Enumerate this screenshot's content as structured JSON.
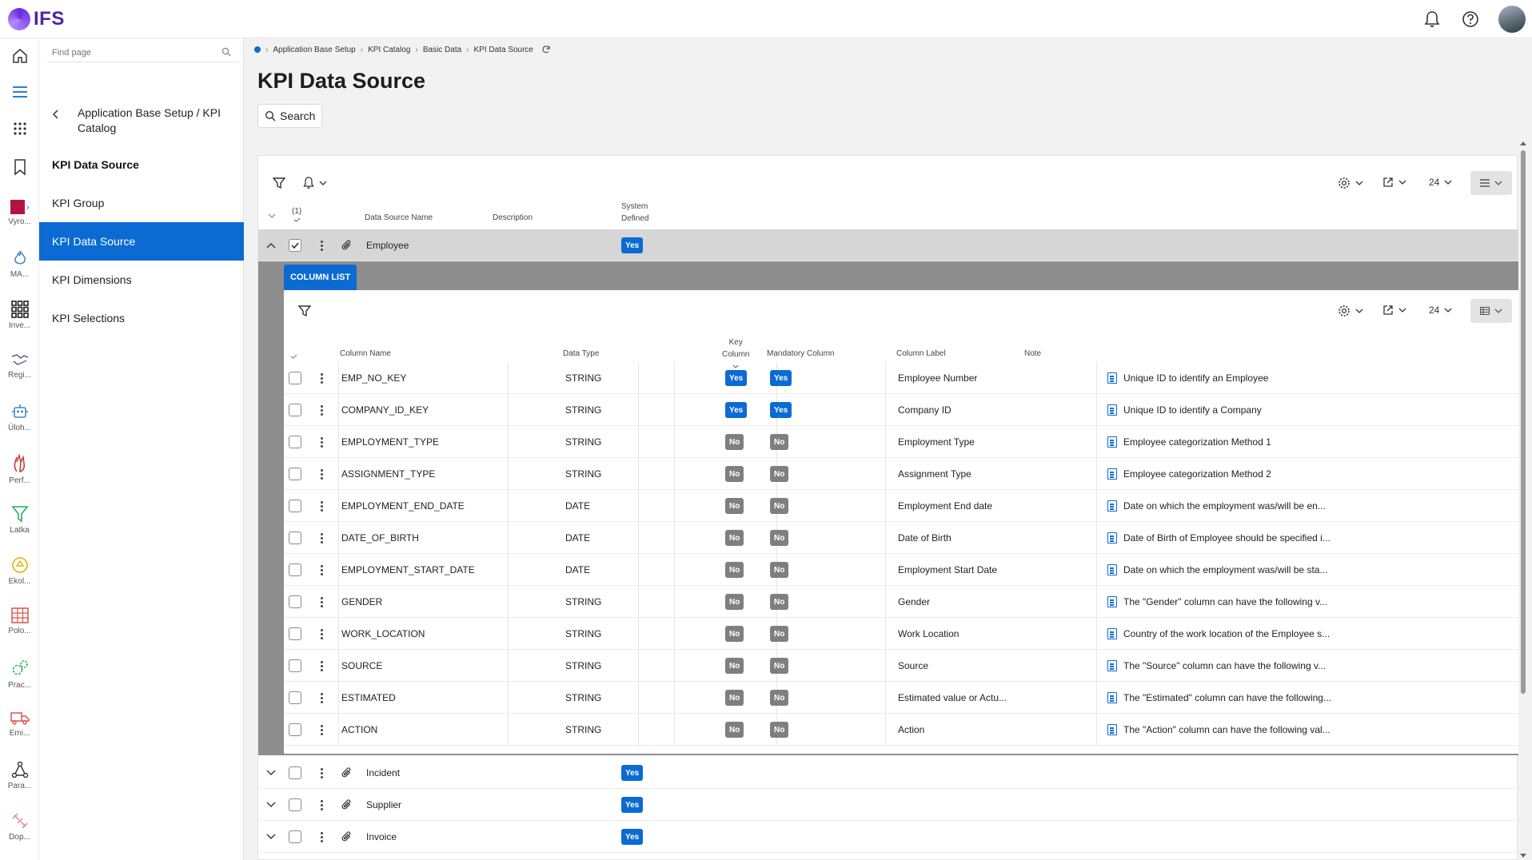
{
  "app": {
    "logo_text": "IFS"
  },
  "topbar": {
    "icons": [
      "bell-icon",
      "help-icon",
      "avatar"
    ]
  },
  "rail": {
    "items": [
      {
        "icon": "home-icon",
        "label": ""
      },
      {
        "icon": "menu-icon",
        "label": ""
      },
      {
        "icon": "apps-grid-icon",
        "label": ""
      },
      {
        "icon": "bookmark-icon",
        "label": ""
      },
      {
        "icon": "square-icon",
        "label": "Vyro..."
      },
      {
        "icon": "flame-icon",
        "label": "MA..."
      },
      {
        "icon": "grid-icon",
        "label": "Inve..."
      },
      {
        "icon": "handshake-icon",
        "label": "Regi..."
      },
      {
        "icon": "robot-icon",
        "label": "Úloh..."
      },
      {
        "icon": "hand-icon",
        "label": "Perf..."
      },
      {
        "icon": "funnel-icon",
        "label": "Latka"
      },
      {
        "icon": "recycle-icon",
        "label": "Ekol..."
      },
      {
        "icon": "table-icon",
        "label": "Polo..."
      },
      {
        "icon": "gears-icon",
        "label": "Prac..."
      },
      {
        "icon": "truck-icon",
        "label": "Emi..."
      },
      {
        "icon": "network-icon",
        "label": "Para..."
      },
      {
        "icon": "satellite-icon",
        "label": "Dop..."
      }
    ]
  },
  "nav": {
    "search_placeholder": "Find page",
    "parent": "Application Base Setup / KPI Catalog",
    "title": "KPI Data Source",
    "items": [
      {
        "label": "KPI Group",
        "active": false
      },
      {
        "label": "KPI Data Source",
        "active": true
      },
      {
        "label": "KPI Dimensions",
        "active": false
      },
      {
        "label": "KPI Selections",
        "active": false
      }
    ]
  },
  "breadcrumb": [
    "Application Base Setup",
    "KPI Catalog",
    "Basic Data",
    "KPI Data Source"
  ],
  "page": {
    "title": "KPI Data Source",
    "search_label": "Search"
  },
  "main_grid": {
    "page_size": "24",
    "selection_count": "(1)",
    "headers": {
      "name": "Data Source Name",
      "description": "Description",
      "system_defined_1": "System",
      "system_defined_2": "Defined"
    },
    "rows": [
      {
        "name": "Employee",
        "system_defined": "Yes",
        "expanded": true,
        "checked": true
      },
      {
        "name": "Incident",
        "system_defined": "Yes",
        "expanded": false,
        "checked": false
      },
      {
        "name": "Supplier",
        "system_defined": "Yes",
        "expanded": false,
        "checked": false
      },
      {
        "name": "Invoice",
        "system_defined": "Yes",
        "expanded": false,
        "checked": false
      }
    ]
  },
  "column_list": {
    "tab_label": "COLUMN LIST",
    "page_size": "24",
    "headers": {
      "column_name": "Column Name",
      "data_type": "Data Type",
      "key_column_1": "Key",
      "key_column_2": "Column",
      "mandatory": "Mandatory Column",
      "label": "Column Label",
      "note": "Note"
    },
    "rows": [
      {
        "name": "EMP_NO_KEY",
        "type": "STRING",
        "key": "Yes",
        "mandatory": "Yes",
        "label": "Employee Number",
        "note": "Unique ID to identify an Employee"
      },
      {
        "name": "COMPANY_ID_KEY",
        "type": "STRING",
        "key": "Yes",
        "mandatory": "Yes",
        "label": "Company ID",
        "note": "Unique ID to identify a Company"
      },
      {
        "name": "EMPLOYMENT_TYPE",
        "type": "STRING",
        "key": "No",
        "mandatory": "No",
        "label": "Employment Type",
        "note": "Employee categorization Method 1"
      },
      {
        "name": "ASSIGNMENT_TYPE",
        "type": "STRING",
        "key": "No",
        "mandatory": "No",
        "label": "Assignment Type",
        "note": "Employee categorization Method 2"
      },
      {
        "name": "EMPLOYMENT_END_DATE",
        "type": "DATE",
        "key": "No",
        "mandatory": "No",
        "label": "Employment End date",
        "note": "Date on which the employment was/will be en..."
      },
      {
        "name": "DATE_OF_BIRTH",
        "type": "DATE",
        "key": "No",
        "mandatory": "No",
        "label": "Date of Birth",
        "note": "Date of Birth of Employee should be specified i..."
      },
      {
        "name": "EMPLOYMENT_START_DATE",
        "type": "DATE",
        "key": "No",
        "mandatory": "No",
        "label": "Employment Start Date",
        "note": "Date on which the employment was/will be sta..."
      },
      {
        "name": "GENDER",
        "type": "STRING",
        "key": "No",
        "mandatory": "No",
        "label": "Gender",
        "note": "The \"Gender\" column can have the following v..."
      },
      {
        "name": "WORK_LOCATION",
        "type": "STRING",
        "key": "No",
        "mandatory": "No",
        "label": "Work Location",
        "note": "Country of the work location of the Employee s..."
      },
      {
        "name": "SOURCE",
        "type": "STRING",
        "key": "No",
        "mandatory": "No",
        "label": "Source",
        "note": "The \"Source\" column can have the following  v..."
      },
      {
        "name": "ESTIMATED",
        "type": "STRING",
        "key": "No",
        "mandatory": "No",
        "label": "Estimated value or Actu...",
        "note": "The \"Estimated\" column can have the following..."
      },
      {
        "name": "ACTION",
        "type": "STRING",
        "key": "No",
        "mandatory": "No",
        "label": "Action",
        "note": "The \"Action\" column can have the following val..."
      }
    ]
  },
  "colors": {
    "accent": "#0b6bd3",
    "badge_no": "#7f7f7f",
    "logo": "#4a25a8"
  }
}
